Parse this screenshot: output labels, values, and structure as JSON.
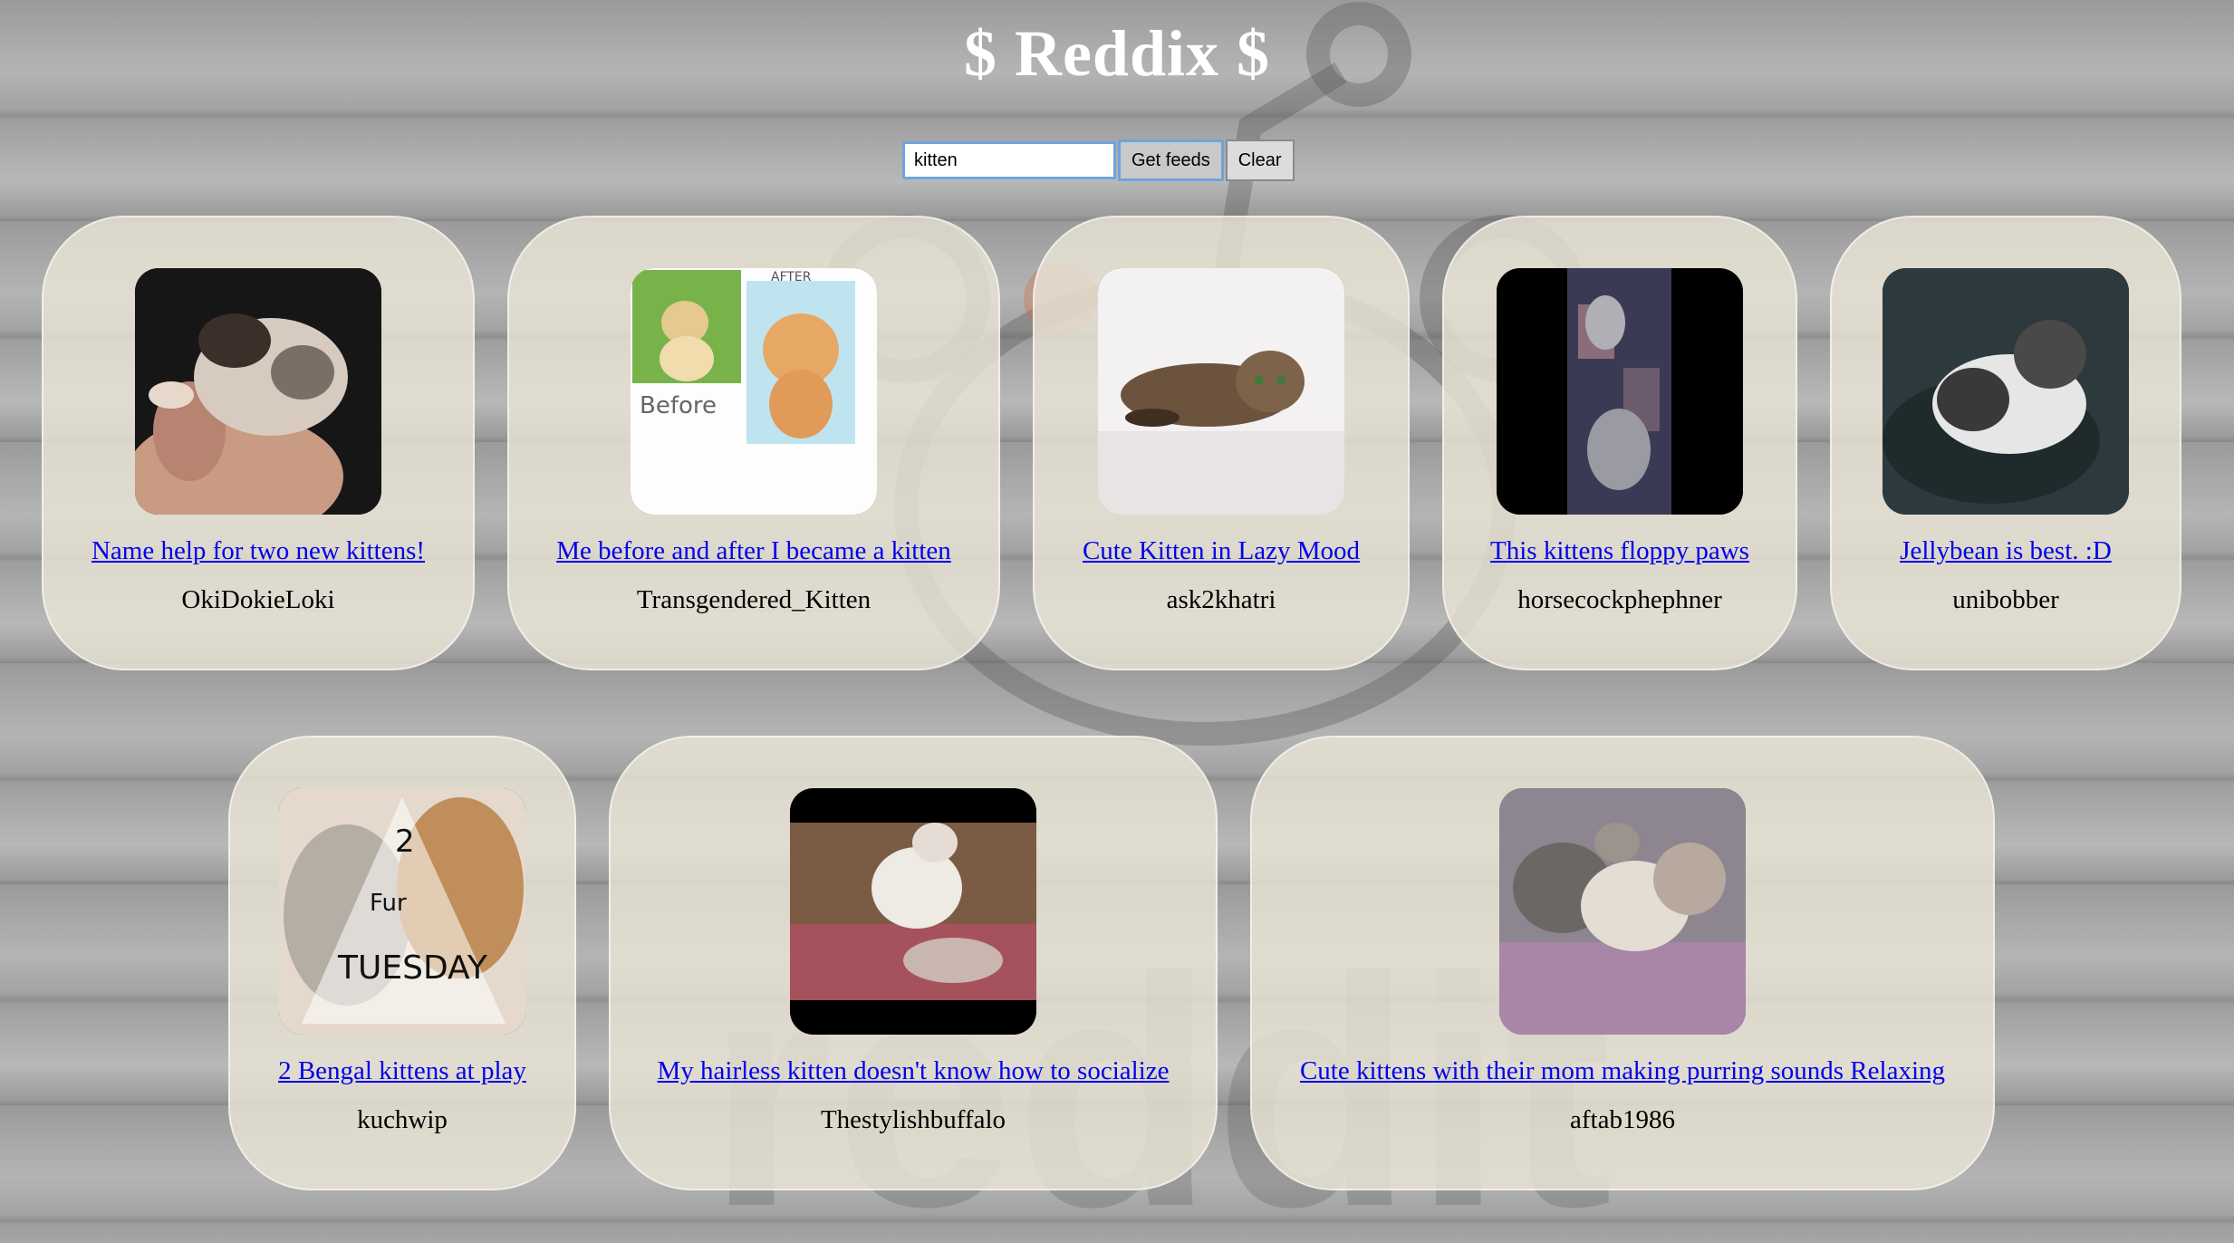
{
  "app": {
    "title": "$ Reddix $"
  },
  "search": {
    "value": "kitten",
    "get_label": "Get feeds",
    "clear_label": "Clear"
  },
  "cards": [
    {
      "title": "Name help for two new kittens!",
      "author": "OkiDokieLoki"
    },
    {
      "title": "Me before and after I became a kitten",
      "author": "Transgendered_Kitten",
      "thumb_text_after": "AFTER",
      "thumb_text_before": "Before"
    },
    {
      "title": "Cute Kitten in Lazy Mood",
      "author": "ask2khatri"
    },
    {
      "title": "This kittens floppy paws",
      "author": "horsecockphephner"
    },
    {
      "title": "Jellybean is best. :D",
      "author": "unibobber"
    },
    {
      "title": "2 Bengal kittens at play",
      "author": "kuchwip",
      "thumb_text_2": "2",
      "thumb_text_fur": "Fur",
      "thumb_text_tuesday": "TUESDAY"
    },
    {
      "title": "My hairless kitten doesn't know how to socialize",
      "author": "Thestylishbuffalo"
    },
    {
      "title": "Cute kittens with their mom making purring sounds Relaxing",
      "author": "aftab1986"
    }
  ],
  "background": {
    "logo_text": "reddit"
  },
  "colors": {
    "card_bg": "#e9e4d6",
    "link": "#0000ee",
    "focus": "#6fa4dc",
    "title": "#ffffff"
  }
}
